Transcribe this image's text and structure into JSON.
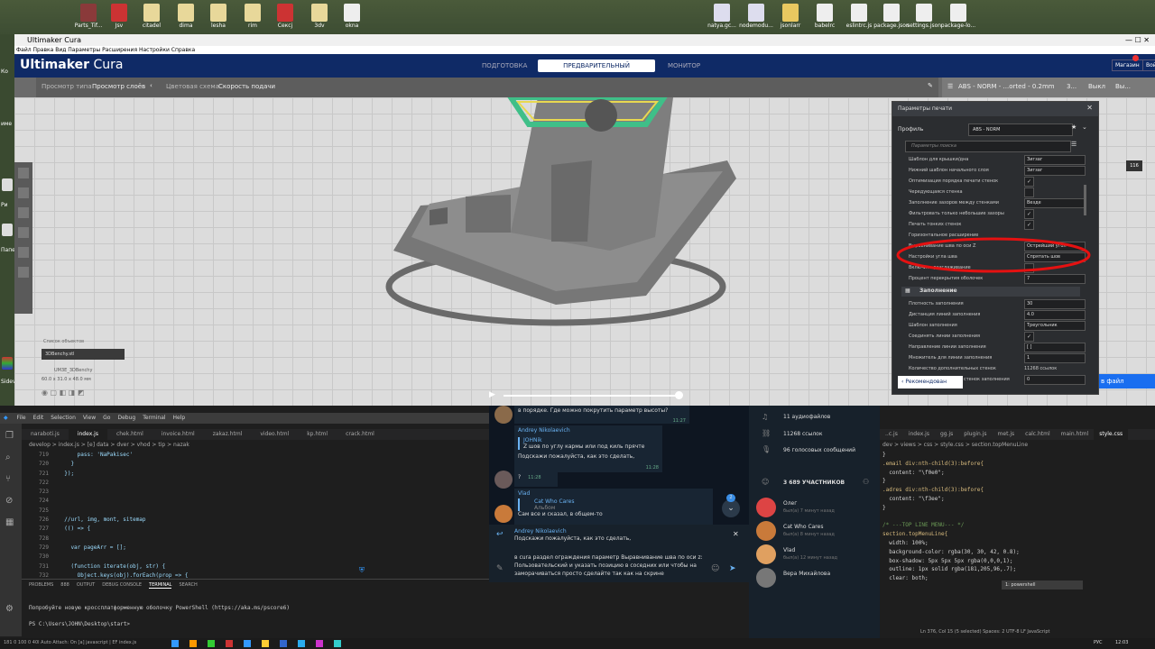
{
  "desktop": {
    "icons": [
      "Parts_Tif...",
      "Jsv",
      "citadel",
      "dima",
      "lesha",
      "rim",
      "Сексj",
      "3dv",
      "okna",
      "natya.gc...",
      "nodemodu...",
      "jsonlarr",
      "babelrc",
      "eslintrc.js",
      "package.json",
      "settings.json",
      "package-lo..."
    ],
    "side_labels": [
      "Ко",
      "име",
      "Ри",
      "Папе",
      "Sidev"
    ]
  },
  "cura": {
    "title": "Ultimaker Cura",
    "menu": "Файл  Правка  Вид  Параметры  Расширения  Настройки  Справка",
    "logo_a": "Ultimaker",
    "logo_b": "Cura",
    "tabs": [
      "ПОДГОТОВКА",
      "ПРЕДВАРИТЕЛЬНЫЙ ПРОСМОТР",
      "МОНИТОР"
    ],
    "market": "Магазин",
    "login": "Войт",
    "view_type_label": "Просмотр типа",
    "view_type_value": "Просмотр слоёв",
    "color_scheme_label": "Цветовая схема",
    "color_scheme_value": "Скорость подачи",
    "printer_profile": "ABS - NORM - ...orted - 0.2mm",
    "printer_extra1": "3...",
    "printer_extra2": "Выкл",
    "printer_extra3": "Вы...",
    "layer_badge": "116",
    "object_list": "Список объектов",
    "object_file": "3DBenchy.stl",
    "object_name": "UM3E_3DBenchy",
    "object_dims": "60.0 x 31.0 x 48.0 мм",
    "settings_panel": {
      "title": "Параметры печати",
      "profile_label": "Профиль",
      "profile_value": "ABS - NORM",
      "search_placeholder": "Параметры поиска",
      "rows": [
        {
          "label": "Шаблон для крышки/дна",
          "value": "Зигзаг",
          "kind": "select"
        },
        {
          "label": "Нижний шаблон начального слоя",
          "value": "Зигзаг",
          "kind": "select"
        },
        {
          "label": "Оптимизация порядка печати стенок",
          "value": "✓",
          "kind": "check"
        },
        {
          "label": "Чередующаяся стенка",
          "value": "",
          "kind": "check"
        },
        {
          "label": "Заполнение зазоров между стенками",
          "value": "Везде",
          "kind": "select"
        },
        {
          "label": "Фильтровать только небольшие зазоры",
          "value": "✓",
          "kind": "check"
        },
        {
          "label": "Печать тонких стенок",
          "value": "✓",
          "kind": "check"
        },
        {
          "label": "Горизонтальное расширение",
          "value": "",
          "kind": "none"
        },
        {
          "label": "Выравнивание шва по оси Z",
          "value": "Острейший угол",
          "kind": "select"
        },
        {
          "label": "Настройки угла шва",
          "value": "Спрятать шов",
          "kind": "select"
        },
        {
          "label": "Включить разглаживание",
          "value": "",
          "kind": "check"
        },
        {
          "label": "Процент перекрытия оболочек",
          "value": "7",
          "kind": "num"
        }
      ],
      "section": "Заполнение",
      "rows2": [
        {
          "label": "Плотность заполнения",
          "value": "30",
          "kind": "num"
        },
        {
          "label": "Дистанция линий заполнения",
          "value": "4.0",
          "kind": "num"
        },
        {
          "label": "Шаблон заполнения",
          "value": "Треугольник",
          "kind": "select"
        },
        {
          "label": "Соединять линии заполнения",
          "value": "✓",
          "kind": "check"
        },
        {
          "label": "Направление линии заполнения",
          "value": "[ ]",
          "kind": "num"
        },
        {
          "label": "Множитель для линии заполнения",
          "value": "1",
          "kind": "num"
        },
        {
          "label": "Количество дополнительных стенок",
          "value": "11268 ссылок",
          "kind": "none"
        },
        {
          "label": "Количество дополнит. стенок заполнения",
          "value": "0",
          "kind": "num"
        }
      ],
      "recommended": "Рекомендован",
      "slice_button": "в файл"
    }
  },
  "vscode": {
    "menu": [
      "File",
      "Edit",
      "Selection",
      "View",
      "Go",
      "Debug",
      "Terminal",
      "Help"
    ],
    "tabs_left": [
      "naraboti.js",
      "index.js",
      "chek.html",
      "invoice.html",
      "zakaz.html",
      "video.html",
      "kp.html",
      "crack.html"
    ],
    "breadcrumb_left": "develop > index.js > [e] data > dver > vhod > tip > nazak",
    "lines": [
      {
        "n": "719",
        "t": "      pass: 'NaPakisec'"
      },
      {
        "n": "720",
        "t": "    }"
      },
      {
        "n": "721",
        "t": "  });"
      },
      {
        "n": "722",
        "t": ""
      },
      {
        "n": "723",
        "t": ""
      },
      {
        "n": "724",
        "t": ""
      },
      {
        "n": "725",
        "t": ""
      },
      {
        "n": "726",
        "t": "  //url, img, mont, sitemap"
      },
      {
        "n": "727",
        "t": "  (() => {"
      },
      {
        "n": "728",
        "t": ""
      },
      {
        "n": "729",
        "t": "    var pageArr = [];"
      },
      {
        "n": "730",
        "t": ""
      },
      {
        "n": "731",
        "t": "    (function iterate(obj, str) {"
      },
      {
        "n": "732",
        "t": "      Object.keys(obj).forEach(prop => {"
      },
      {
        "n": "733",
        "t": "        if (typeof obj[prop] == 'object' && !(obj[prop] instanceof Kategor || obj[prop] instance"
      }
    ],
    "panel_tabs": [
      "PROBLEMS",
      "888",
      "OUTPUT",
      "DEBUG CONSOLE",
      "TERMINAL",
      "SEARCH"
    ],
    "terminal_select": "1: powershell",
    "terminal_line1": "Попробуйте новую кроссплатформенную оболочку PowerShell (https://aka.ms/pscore6)",
    "terminal_line2": "PS C:\\Users\\JOHN\\Desktop\\start>",
    "tabs_right": [
      "..c.js",
      "index.js",
      "gg.js",
      "plugin.js",
      "met.js",
      "calc.html",
      "main.html",
      "style.css"
    ],
    "breadcrumb_right": "dev > views > css > style.css > section.topMenuLine",
    "css_lines": [
      "}",
      ".email div:nth-child(3):before{",
      "  content: \"\\f0e0\";",
      "}",
      ".adres div:nth-child(3):before{",
      "  content: \"\\f3ee\";",
      "}",
      "",
      "/* ---TOP LINE MENU--- */",
      "section.topMenuLine{",
      "  width: 100%;",
      "  background-color: rgba(30, 30, 42, 0.8);",
      "  box-shadow: 5px 5px 5px rgba(0,0,0,1);",
      "  outline: 1px solid rgba(181,205,96,.7);",
      "  clear: both;"
    ],
    "status": "Ln 376, Col 15 (5 selected)   Spaces: 2   UTF-8   LF   JavaScript"
  },
  "telegram": {
    "msg1": "в порядке. Где можно покрутить параметр высоты?",
    "msg1_time": "11:27",
    "author2": "Andrey Nikolaevich",
    "quote2_name": "JOHNik",
    "quote2_text": "Z шов по углу кармы или под киль прячте",
    "msg2": "Подскажи пожалуйста, как это сделать,",
    "msg2_time": "11:28",
    "msg3": "?",
    "msg3_time": "11:28",
    "author4": "Vlad",
    "quote4_name": "Cat Who Cares",
    "quote4_text": "Альбом",
    "msg4": "Сам все и сказал, в общем-то",
    "scroll_badge": "2",
    "reply_name": "Andrey Nikolaevich",
    "reply_text": "Подскажи пожалуйста, как это сделать,",
    "input_text": "в cura раздел ограждения параметр Выравнивание шва по оси z: Пользовательский и указать позицию в соседних или чтобы на заморачиваться просто сделайте так как на скрине",
    "side": {
      "audio": "11 аудиофайлов",
      "links": "11268 ссылок",
      "voice": "96 голосовых сообщений",
      "members": "3 689 УЧАСТНИКОВ",
      "users": [
        {
          "name": "Олег",
          "status": "был(а) 7 минут назад"
        },
        {
          "name": "Cat Who Cares",
          "status": "был(а) 8 минут назад"
        },
        {
          "name": "Vlad",
          "status": "был(а) 12 минут назад"
        },
        {
          "name": "Вера Михайлова",
          "status": ""
        }
      ]
    }
  },
  "taskbar": {
    "left": "181  0  100  0  40l   Auto Attach: On   [a] javascript | EF index.js",
    "lang": "РУС",
    "time": "12:03"
  }
}
